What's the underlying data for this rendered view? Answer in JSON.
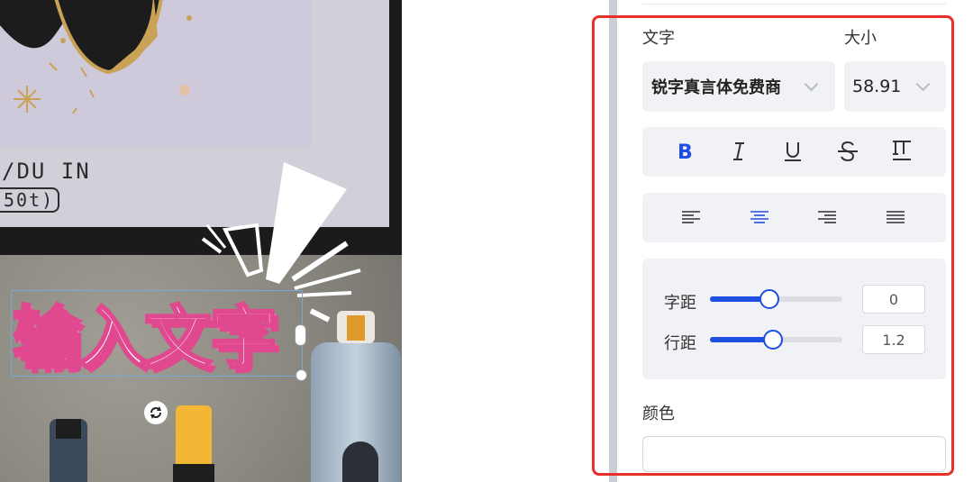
{
  "canvas": {
    "print_line1": "/DU IN",
    "print_line2": "50t)",
    "main_text": "输入文字"
  },
  "panel": {
    "font_label": "文字",
    "size_label": "大小",
    "font_value": "锐字真言体免费商",
    "size_value": "58.91",
    "style_buttons": [
      {
        "name": "bold-button",
        "glyph": "B",
        "active": true
      },
      {
        "name": "italic-button",
        "glyph": "I",
        "active": false
      },
      {
        "name": "underline-button",
        "glyph": "U",
        "active": false
      },
      {
        "name": "strikethrough-button",
        "glyph": "S",
        "active": false
      },
      {
        "name": "vertical-text-button",
        "glyph": "IT",
        "active": false
      }
    ],
    "align_buttons": [
      {
        "name": "align-left-button",
        "active": false
      },
      {
        "name": "align-center-button",
        "active": true
      },
      {
        "name": "align-right-button",
        "active": false
      },
      {
        "name": "align-justify-button",
        "active": false
      }
    ],
    "letter_spacing_label": "字距",
    "letter_spacing_value": "0",
    "line_height_label": "行距",
    "line_height_value": "1.2",
    "color_label": "颜色"
  },
  "colors": {
    "accent": "#1f4fe0",
    "highlight": "#e8302a",
    "text_stroke": "#e0488f"
  }
}
